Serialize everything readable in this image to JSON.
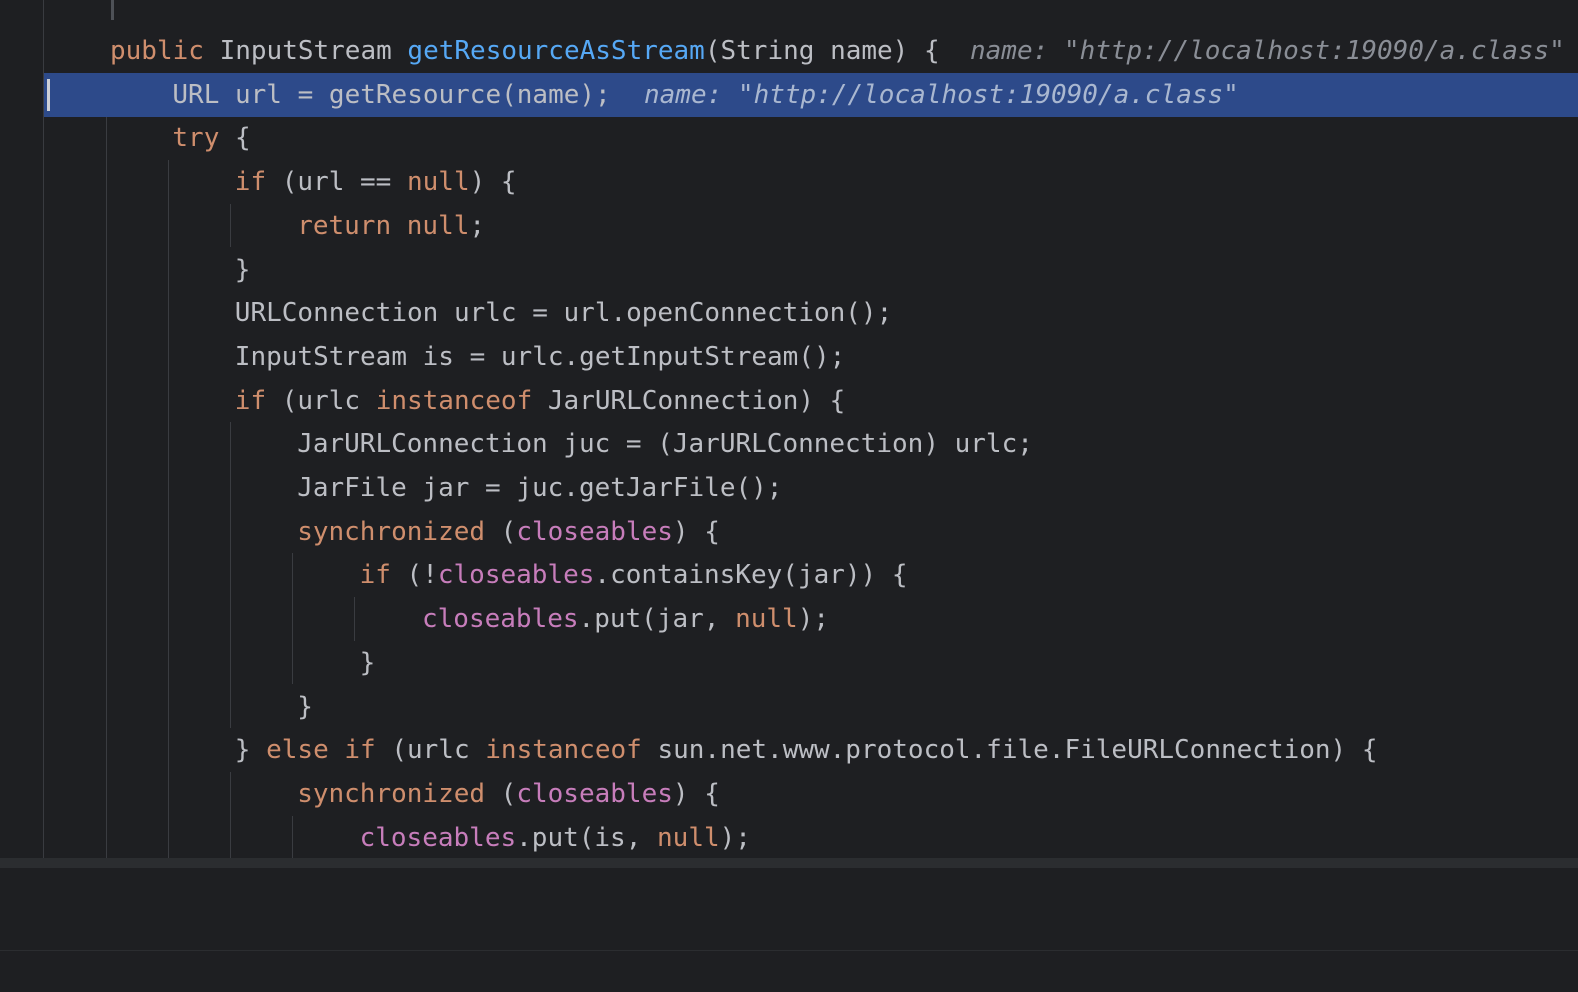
{
  "editor": {
    "lines": [
      {
        "segments": [
          {
            "t": "public",
            "c": "kw"
          },
          {
            "t": " InputStream "
          },
          {
            "t": "getResourceAsStream",
            "c": "fn"
          },
          {
            "t": "(String name) {"
          }
        ],
        "hint": "name: \"http://localhost:19090/a.class\""
      },
      {
        "segments": [
          {
            "t": "URL url = getResource(name);"
          }
        ],
        "hint": "name: \"http://localhost:19090/a.class\"",
        "highlight": true
      },
      {
        "segments": [
          {
            "t": "try",
            "c": "kw"
          },
          {
            "t": " {"
          }
        ]
      },
      {
        "segments": [
          {
            "t": "if",
            "c": "kw"
          },
          {
            "t": " (url == "
          },
          {
            "t": "null",
            "c": "kw"
          },
          {
            "t": ") {"
          }
        ]
      },
      {
        "segments": [
          {
            "t": "return",
            "c": "kw"
          },
          {
            "t": " "
          },
          {
            "t": "null",
            "c": "kw"
          },
          {
            "t": ";"
          }
        ]
      },
      {
        "segments": [
          {
            "t": "}"
          }
        ]
      },
      {
        "segments": [
          {
            "t": "URLConnection urlc = url.openConnection();"
          }
        ]
      },
      {
        "segments": [
          {
            "t": "InputStream is = urlc.getInputStream();"
          }
        ]
      },
      {
        "segments": [
          {
            "t": "if",
            "c": "kw"
          },
          {
            "t": " (urlc "
          },
          {
            "t": "instanceof",
            "c": "kw"
          },
          {
            "t": " JarURLConnection) {"
          }
        ]
      },
      {
        "segments": [
          {
            "t": "JarURLConnection juc = (JarURLConnection) urlc;"
          }
        ]
      },
      {
        "segments": [
          {
            "t": "JarFile jar = juc.getJarFile();"
          }
        ]
      },
      {
        "segments": [
          {
            "t": "synchronized",
            "c": "kw"
          },
          {
            "t": " ("
          },
          {
            "t": "closeables",
            "c": "fld"
          },
          {
            "t": ") {"
          }
        ]
      },
      {
        "segments": [
          {
            "t": "if",
            "c": "kw"
          },
          {
            "t": " (!"
          },
          {
            "t": "closeables",
            "c": "fld"
          },
          {
            "t": ".containsKey(jar)) {"
          }
        ]
      },
      {
        "segments": [
          {
            "t": "closeables",
            "c": "fld"
          },
          {
            "t": ".put(jar, "
          },
          {
            "t": "null",
            "c": "kw"
          },
          {
            "t": ");"
          }
        ]
      },
      {
        "segments": [
          {
            "t": "}"
          }
        ]
      },
      {
        "segments": [
          {
            "t": "}"
          }
        ]
      },
      {
        "segments": [
          {
            "t": "} "
          },
          {
            "t": "else if",
            "c": "kw"
          },
          {
            "t": " (urlc "
          },
          {
            "t": "instanceof",
            "c": "kw"
          },
          {
            "t": " sun.net.www.protocol.file.FileURLConnection) {"
          }
        ]
      },
      {
        "segments": [
          {
            "t": "synchronized",
            "c": "kw"
          },
          {
            "t": " ("
          },
          {
            "t": "closeables",
            "c": "fld"
          },
          {
            "t": ") {"
          }
        ]
      },
      {
        "segments": [
          {
            "t": "closeables",
            "c": "fld"
          },
          {
            "t": ".put(is, "
          },
          {
            "t": "null",
            "c": "kw"
          },
          {
            "t": ");"
          }
        ]
      }
    ]
  }
}
